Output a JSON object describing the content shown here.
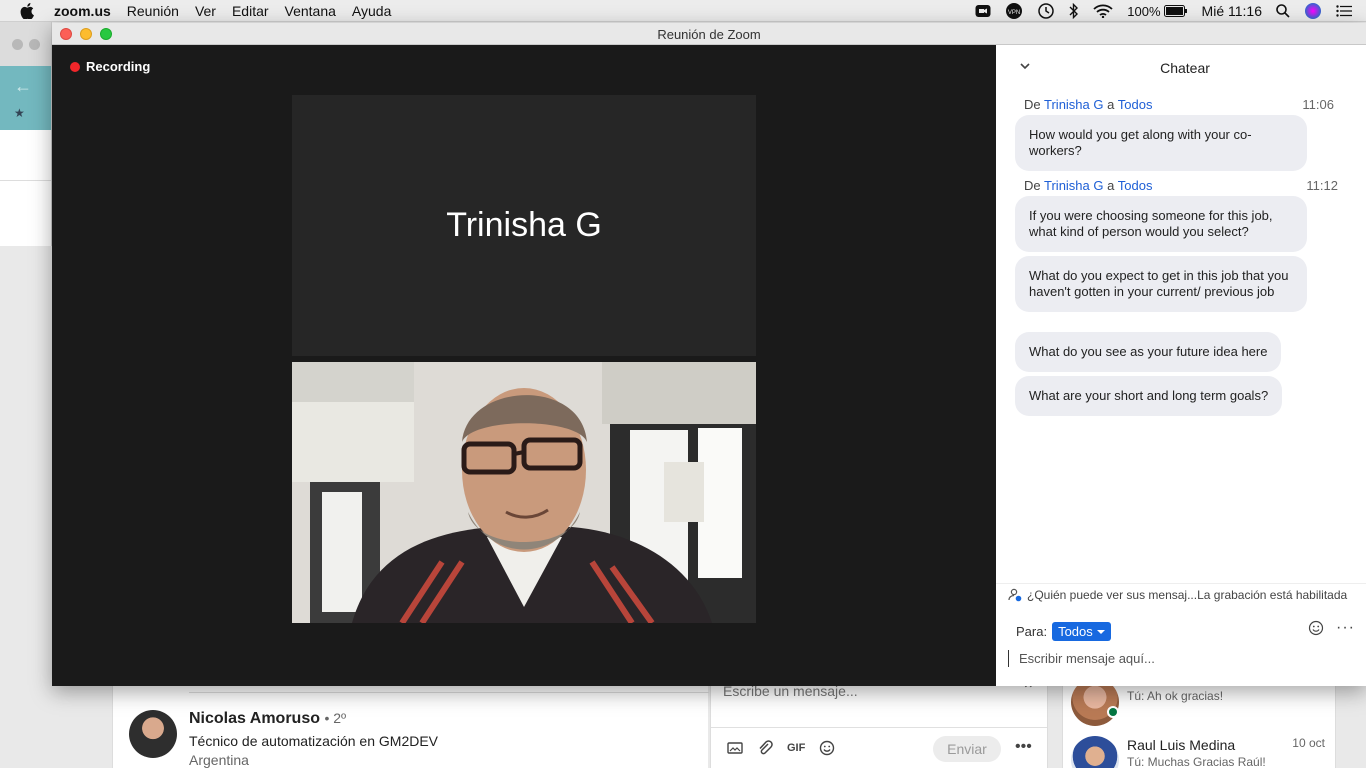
{
  "menubar": {
    "app": "zoom.us",
    "items": [
      "Reunión",
      "Ver",
      "Editar",
      "Ventana",
      "Ayuda"
    ],
    "battery": "100%",
    "clock": "Mié 11:16"
  },
  "window": {
    "title": "Reunión de Zoom",
    "recording_label": "Recording",
    "participant_name": "Trinisha G"
  },
  "chat": {
    "title": "Chatear",
    "groups": [
      {
        "prefix": "De",
        "sender": "Trinisha G",
        "joiner": "a",
        "recipient": "Todos",
        "time": "11:06",
        "messages": [
          "How would you get along with your co-workers?"
        ]
      },
      {
        "prefix": "De",
        "sender": "Trinisha G",
        "joiner": "a",
        "recipient": "Todos",
        "time": "11:12",
        "messages": [
          "If you were choosing someone for this job, what kind of person would you select?",
          "What do you expect to get in this job that you haven't gotten in your current/ previous job",
          "What do you see as your future idea here",
          "What are your short and long term goals?"
        ]
      }
    ],
    "privacy_notice": "¿Quién puede ver sus mensaj...La grabación está habilitada",
    "to_label": "Para:",
    "to_value": "Todos",
    "input_placeholder": "Escribir mensaje aquí..."
  },
  "background": {
    "profile": {
      "name": "Nicolas Amoruso",
      "degree": "• 2º",
      "headline": "Técnico de automatización en GM2DEV",
      "location": "Argentina"
    },
    "compose": {
      "placeholder": "Escribe un mensaje...",
      "send_label": "Enviar",
      "gif_label": "GIF"
    },
    "conversations": [
      {
        "name": "",
        "preview": "Tú: Ah ok gracias!",
        "date": ""
      },
      {
        "name": "Raul Luis Medina",
        "preview": "Tú: Muchas Gracias Raúl!",
        "date": "10 oct"
      }
    ]
  }
}
